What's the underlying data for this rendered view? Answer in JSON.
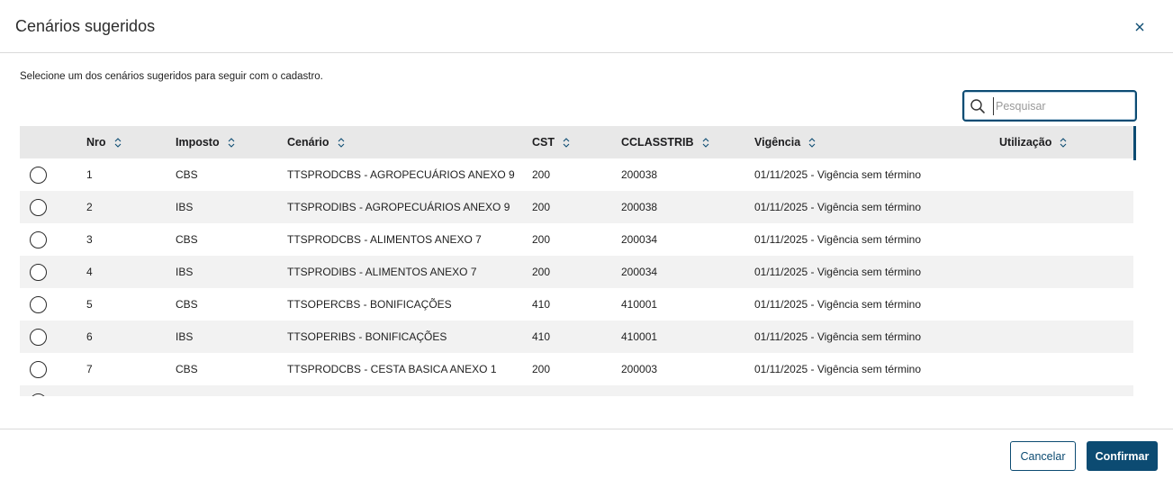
{
  "modal": {
    "title": "Cenários sugeridos",
    "instruction": "Selecione um dos cenários sugeridos para seguir com o cadastro."
  },
  "search": {
    "placeholder": "Pesquisar",
    "value": ""
  },
  "table": {
    "columns": [
      "Nro",
      "Imposto",
      "Cenário",
      "CST",
      "CCLASSTRIB",
      "Vigência",
      "Utilização"
    ],
    "rows": [
      [
        "1",
        "CBS",
        "TTSPRODCBS - AGROPECUÁRIOS ANEXO 9",
        "200",
        "200038",
        "01/11/2025 - Vigência sem término",
        ""
      ],
      [
        "2",
        "IBS",
        "TTSPRODIBS - AGROPECUÁRIOS ANEXO 9",
        "200",
        "200038",
        "01/11/2025 - Vigência sem término",
        ""
      ],
      [
        "3",
        "CBS",
        "TTSPRODCBS - ALIMENTOS ANEXO 7",
        "200",
        "200034",
        "01/11/2025 - Vigência sem término",
        ""
      ],
      [
        "4",
        "IBS",
        "TTSPRODIBS - ALIMENTOS ANEXO 7",
        "200",
        "200034",
        "01/11/2025 - Vigência sem término",
        ""
      ],
      [
        "5",
        "CBS",
        "TTSOPERCBS - BONIFICAÇÕES",
        "410",
        "410001",
        "01/11/2025 - Vigência sem término",
        ""
      ],
      [
        "6",
        "IBS",
        "TTSOPERIBS - BONIFICAÇÕES",
        "410",
        "410001",
        "01/11/2025 - Vigência sem término",
        ""
      ],
      [
        "7",
        "CBS",
        "TTSPRODCBS - CESTA BASICA ANEXO 1",
        "200",
        "200003",
        "01/11/2025 - Vigência sem término",
        ""
      ]
    ]
  },
  "footer": {
    "cancel_label": "Cancelar",
    "confirm_label": "Confirmar"
  },
  "icons": {
    "close": "close-icon",
    "search": "search-icon",
    "sort": "sort-icon"
  },
  "colors": {
    "primary": "#0c4b72",
    "header_bg": "#e8e8e8",
    "row_alt": "#f2f2f2"
  }
}
